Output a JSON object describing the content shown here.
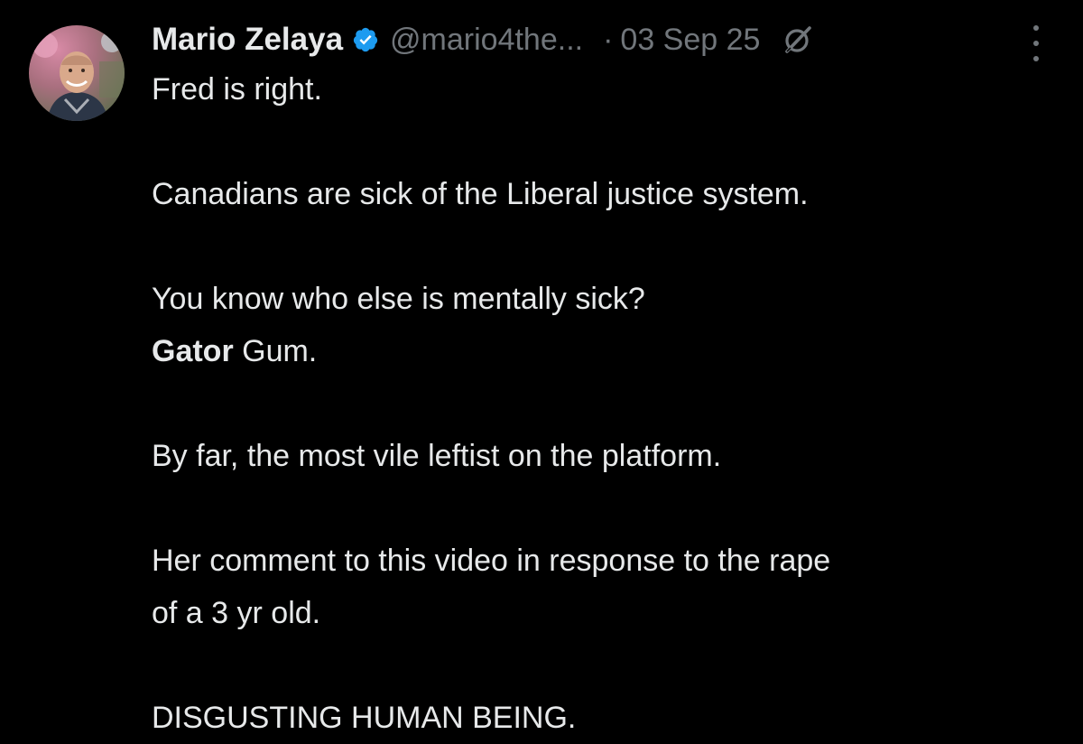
{
  "tweet": {
    "author": {
      "display_name": "Mario Zelaya",
      "handle": "@mario4the...",
      "verified": true,
      "verified_color": "#1d9bf0"
    },
    "separator": "·",
    "timestamp": "03 Sep 25",
    "icons": {
      "grok": "grok-icon",
      "more": "more-options-icon",
      "verified": "verified-badge-icon"
    },
    "lines": {
      "l1": "Fred is right.",
      "l2": "Canadians are sick of the Liberal justice system.",
      "l3": "You know who else is mentally sick?",
      "l4_bold": "Gator",
      "l4_rest": " Gum.",
      "l5": "By far, the most vile leftist on the platform.",
      "l6": "Her comment to this video in response to the rape",
      "l7": "of a 3 yr old.",
      "l8": "DISGUSTING HUMAN BEING."
    },
    "colors": {
      "background": "#000000",
      "text_primary": "#e7e9ea",
      "text_secondary": "#71767b"
    }
  }
}
